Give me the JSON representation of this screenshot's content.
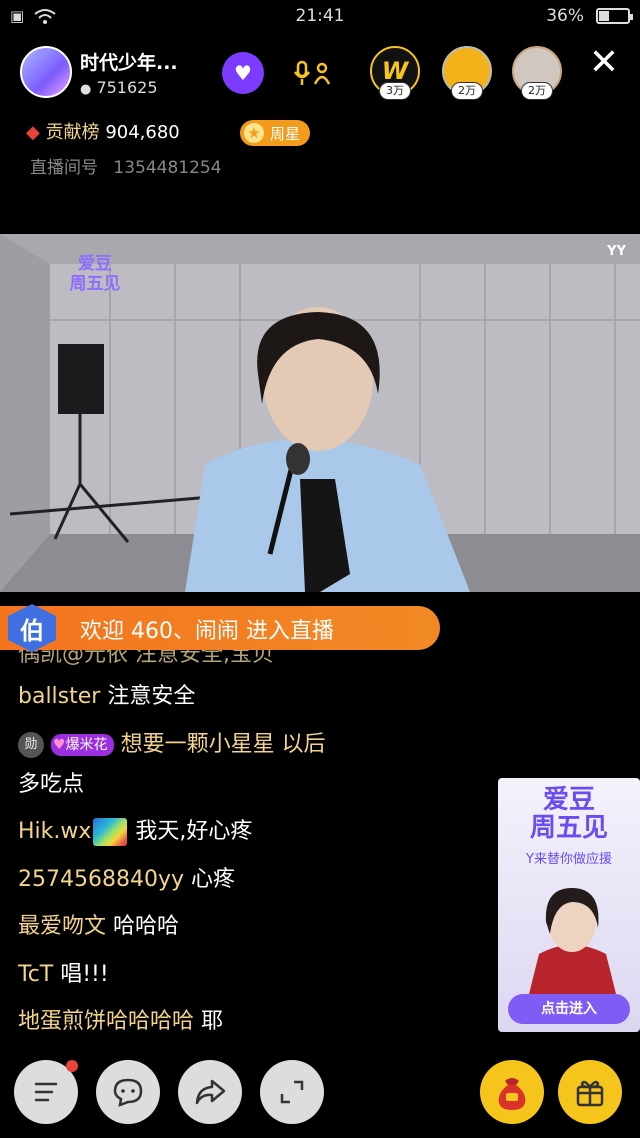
{
  "status": {
    "time": "21:41",
    "battery": "36%",
    "battery_level": 0.36
  },
  "header": {
    "host_name": "时代少年...",
    "fans": "751625",
    "fan_badges": [
      "3万",
      "2万",
      "2万"
    ],
    "contribution_label": "贡献榜",
    "contribution_value": "904,680",
    "week_star": "周星",
    "room_label": "直播间号",
    "room_no": "1354481254"
  },
  "video": {
    "watermark": "YY",
    "logo_line1": "爱豆",
    "logo_line2": "周五见"
  },
  "welcome": {
    "level": "伯",
    "text": "欢迎 460、闹闹 进入直播"
  },
  "chat": [
    {
      "user": "ballster",
      "text": "注意安全"
    },
    {
      "badge": "勋",
      "tag": "爆米花",
      "text": "想要一颗小星星 以后",
      "cont": "多吃点"
    },
    {
      "user": "Hik.wx",
      "text": "我天,好心疼"
    },
    {
      "user": "2574568840yy",
      "text": "心疼"
    },
    {
      "user": "最爱吻文",
      "text": "哈哈哈"
    },
    {
      "user": "TcT",
      "text": "唱!!!"
    },
    {
      "user": "地蛋煎饼哈哈哈哈",
      "text": "耶"
    }
  ],
  "partial_line": "偶凯@元依 注意安全,宝贝",
  "promo": {
    "title1": "爱豆",
    "title2": "周五见",
    "subtitle": "Y来替你做应援",
    "cta": "点击进入"
  },
  "colors": {
    "accent": "#f6c51c",
    "welcome": "#f4741e",
    "username": "#f3d48a",
    "purple": "#7c3cff"
  }
}
